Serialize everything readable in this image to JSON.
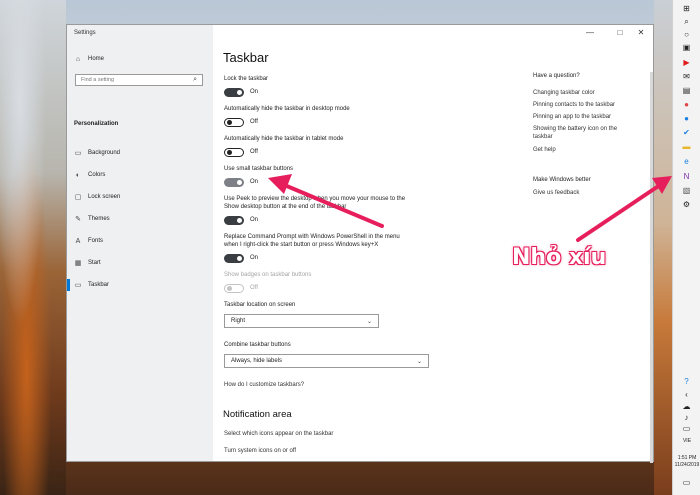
{
  "window": {
    "title": "Settings"
  },
  "nav": {
    "home": "Home",
    "search_placeholder": "Find a setting",
    "section": "Personalization",
    "items": [
      {
        "label": "Background",
        "icon": "image-icon"
      },
      {
        "label": "Colors",
        "icon": "palette-icon"
      },
      {
        "label": "Lock screen",
        "icon": "monitor-icon"
      },
      {
        "label": "Themes",
        "icon": "brush-icon"
      },
      {
        "label": "Fonts",
        "icon": "font-icon"
      },
      {
        "label": "Start",
        "icon": "start-icon"
      },
      {
        "label": "Taskbar",
        "icon": "taskbar-icon"
      }
    ],
    "active": "Taskbar"
  },
  "main": {
    "title": "Taskbar",
    "settings": [
      {
        "label": "Lock the taskbar",
        "state": "On",
        "on": true
      },
      {
        "label": "Automatically hide the taskbar in desktop mode",
        "state": "Off",
        "on": false
      },
      {
        "label": "Automatically hide the taskbar in tablet mode",
        "state": "Off",
        "on": false
      },
      {
        "label": "Use small taskbar buttons",
        "state": "On",
        "on": true
      },
      {
        "label_line1": "Use Peek to preview the desktop when you move your mouse to the",
        "label_line2": "Show desktop button at the end of the taskbar",
        "state": "On",
        "on": true
      },
      {
        "label_line1": "Replace Command Prompt with Windows PowerShell in the menu",
        "label_line2": "when I right-click the start button or press Windows key+X",
        "state": "On",
        "on": true
      },
      {
        "label": "Show badges on taskbar buttons",
        "state": "Off",
        "on": false,
        "disabled": true
      }
    ],
    "location": {
      "label": "Taskbar location on screen",
      "value": "Right"
    },
    "combine": {
      "label": "Combine taskbar buttons",
      "value": "Always, hide labels"
    },
    "help_link": "How do I customize taskbars?",
    "notification": {
      "title": "Notification area",
      "links": [
        "Select which icons appear on the taskbar",
        "Turn system icons on or off"
      ]
    }
  },
  "side": {
    "question_title": "Have a question?",
    "question_links": [
      "Changing taskbar color",
      "Pinning contacts to the taskbar",
      "Pinning an app to the taskbar",
      "Showing the battery icon on the taskbar",
      "Get help"
    ],
    "better_title": "Make Windows better",
    "better_link": "Give us feedback"
  },
  "taskbar": {
    "language": "VIE",
    "time": "1:51 PM",
    "date": "11/24/2019",
    "icons": [
      "windows-start-icon",
      "search-icon",
      "cortana-icon",
      "task-view-icon",
      "youtube-icon",
      "mail-icon",
      "store-icon",
      "chrome-icon",
      "messenger-icon",
      "todo-icon",
      "folder-icon",
      "edge-icon",
      "onenote-icon",
      "photos-icon",
      "settings-icon"
    ]
  },
  "annotation": {
    "text": "Nhỏ xíu",
    "color": "#e61e5c"
  },
  "colors": {
    "accent": "#0078d7",
    "toggle_on": "#3a3d42"
  }
}
